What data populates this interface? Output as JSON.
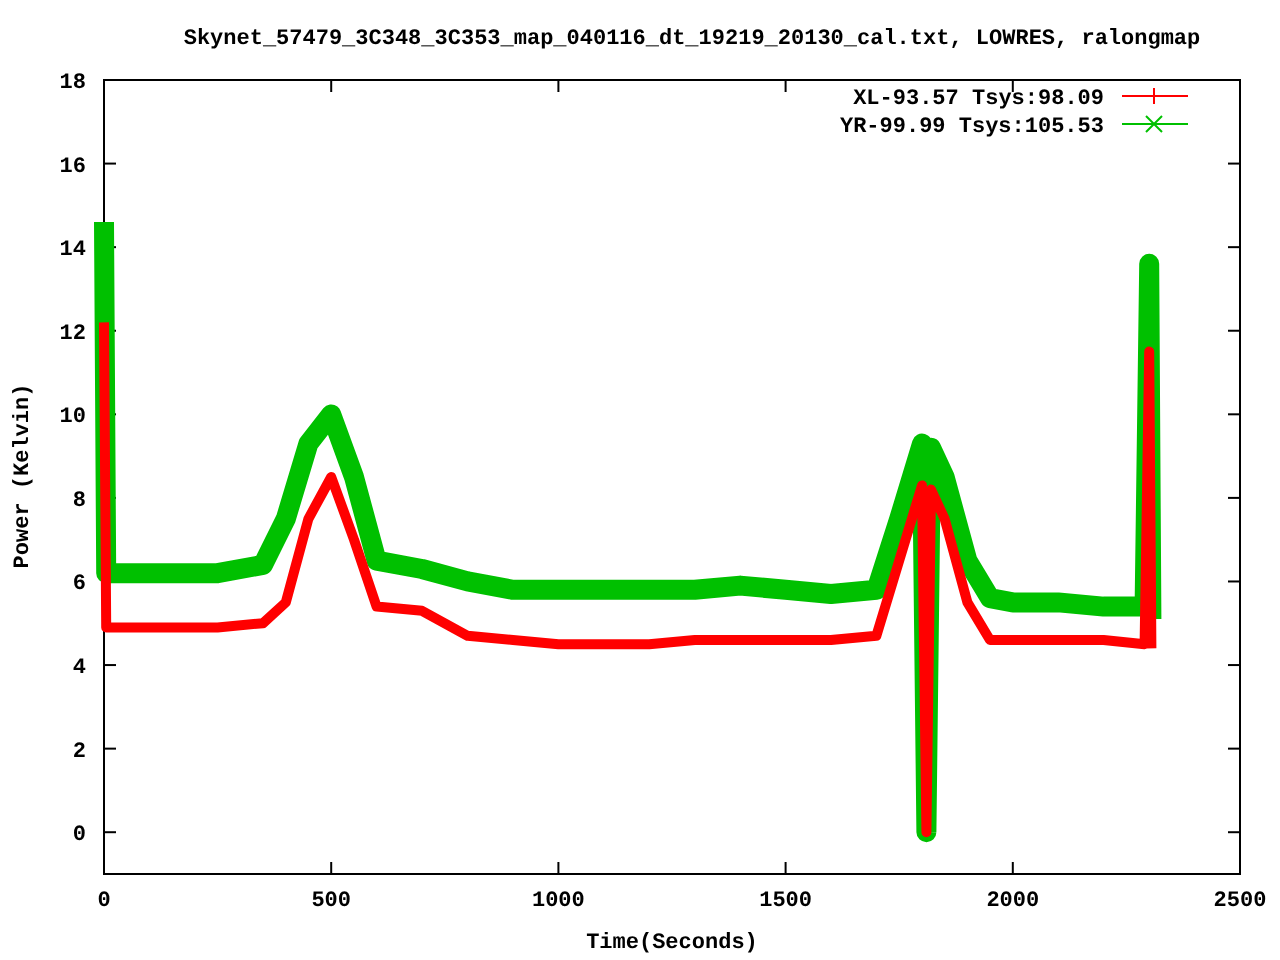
{
  "chart_data": {
    "type": "line",
    "title": "Skynet_57479_3C348_3C353_map_040116_dt_19219_20130_cal.txt, LOWRES, ralongmap",
    "xlabel": "Time(Seconds)",
    "ylabel": "Power (Kelvin)",
    "x": [
      0,
      5,
      50,
      150,
      250,
      350,
      400,
      450,
      500,
      550,
      600,
      700,
      800,
      900,
      1000,
      1100,
      1200,
      1300,
      1400,
      1500,
      1600,
      1700,
      1750,
      1800,
      1810,
      1820,
      1850,
      1900,
      1950,
      2000,
      2100,
      2200,
      2290,
      2300,
      2305
    ],
    "series": [
      {
        "name": "XL-93.57 Tsys:98.09",
        "color": "#ff0000",
        "values": [
          12.2,
          4.9,
          4.9,
          4.9,
          4.9,
          5.0,
          5.5,
          7.5,
          8.5,
          7,
          5.4,
          5.3,
          4.7,
          4.6,
          4.5,
          4.5,
          4.5,
          4.6,
          4.6,
          4.6,
          4.6,
          4.7,
          6.5,
          8.3,
          0,
          8.2,
          7.5,
          5.5,
          4.6,
          4.6,
          4.6,
          4.6,
          4.5,
          11.5,
          4.4
        ]
      },
      {
        "name": "YR-99.99 Tsys:105.53",
        "color": "#00c000",
        "values": [
          14.6,
          6.2,
          6.2,
          6.2,
          6.2,
          6.4,
          7.5,
          9.3,
          10,
          8.5,
          6.5,
          6.3,
          6.0,
          5.8,
          5.8,
          5.8,
          5.8,
          5.8,
          5.9,
          5.8,
          5.7,
          5.8,
          7.5,
          9.3,
          0,
          9.2,
          8.5,
          6.5,
          5.6,
          5.5,
          5.5,
          5.4,
          5.4,
          13.6,
          5.1
        ]
      }
    ],
    "legend": true,
    "xlim": [
      0,
      2500
    ],
    "ylim": [
      -1,
      18
    ],
    "xticks": [
      0,
      500,
      1000,
      1500,
      2000,
      2500
    ],
    "yticks": [
      0,
      2,
      4,
      6,
      8,
      10,
      12,
      14,
      16,
      18
    ]
  }
}
